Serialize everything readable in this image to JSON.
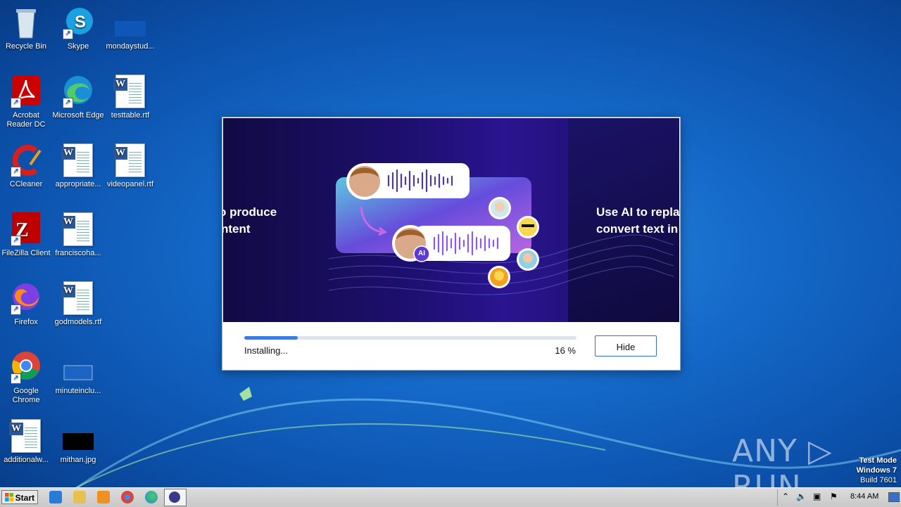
{
  "desktop": {
    "icons": [
      {
        "label": "Recycle Bin"
      },
      {
        "label": "Skype"
      },
      {
        "label": "mondaystud..."
      },
      {
        "label": "Acrobat\nReader DC"
      },
      {
        "label": "Microsoft Edge"
      },
      {
        "label": "testtable.rtf"
      },
      {
        "label": "CCleaner"
      },
      {
        "label": "appropriate..."
      },
      {
        "label": "videopanel.rtf"
      },
      {
        "label": "FileZilla Client"
      },
      {
        "label": "franciscoha..."
      },
      {
        "label": "Firefox"
      },
      {
        "label": "godmodels.rtf"
      },
      {
        "label": "Google\nChrome"
      },
      {
        "label": "minuteinclu..."
      },
      {
        "label": "additionalw..."
      },
      {
        "label": "mithan.jpg"
      }
    ]
  },
  "installer": {
    "banner_left_text": [
      "o produce",
      "ntent"
    ],
    "banner_right_text": [
      "Use AI to repla",
      "convert text in"
    ],
    "ai_badge": "AI",
    "status": "Installing...",
    "percent_label": "16 %",
    "progress": 0.16,
    "hide_button": "Hide",
    "accent_color": "#3d7be0"
  },
  "watermark": "ANY ▷ RUN",
  "test_mode": {
    "line1": "Test Mode",
    "line2": "Windows 7",
    "line3": "Build 7601"
  },
  "taskbar": {
    "start_label": "Start",
    "clock": "8:44 AM",
    "pinned": [
      "internet-explorer-icon",
      "explorer-icon",
      "media-player-icon",
      "chrome-icon",
      "edge-icon",
      "installer-app-icon"
    ]
  }
}
